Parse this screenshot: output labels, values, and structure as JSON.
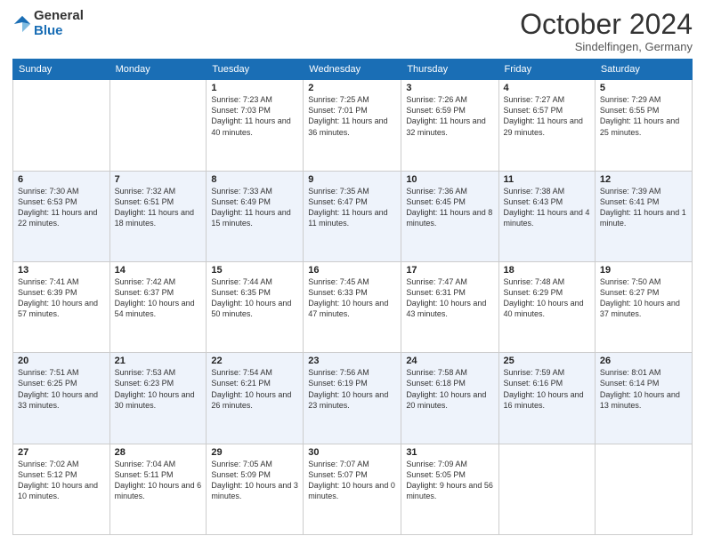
{
  "logo": {
    "line1": "General",
    "line2": "Blue"
  },
  "header": {
    "month": "October 2024",
    "location": "Sindelfingen, Germany"
  },
  "weekdays": [
    "Sunday",
    "Monday",
    "Tuesday",
    "Wednesday",
    "Thursday",
    "Friday",
    "Saturday"
  ],
  "weeks": [
    [
      {
        "day": "",
        "info": ""
      },
      {
        "day": "",
        "info": ""
      },
      {
        "day": "1",
        "info": "Sunrise: 7:23 AM\nSunset: 7:03 PM\nDaylight: 11 hours and 40 minutes."
      },
      {
        "day": "2",
        "info": "Sunrise: 7:25 AM\nSunset: 7:01 PM\nDaylight: 11 hours and 36 minutes."
      },
      {
        "day": "3",
        "info": "Sunrise: 7:26 AM\nSunset: 6:59 PM\nDaylight: 11 hours and 32 minutes."
      },
      {
        "day": "4",
        "info": "Sunrise: 7:27 AM\nSunset: 6:57 PM\nDaylight: 11 hours and 29 minutes."
      },
      {
        "day": "5",
        "info": "Sunrise: 7:29 AM\nSunset: 6:55 PM\nDaylight: 11 hours and 25 minutes."
      }
    ],
    [
      {
        "day": "6",
        "info": "Sunrise: 7:30 AM\nSunset: 6:53 PM\nDaylight: 11 hours and 22 minutes."
      },
      {
        "day": "7",
        "info": "Sunrise: 7:32 AM\nSunset: 6:51 PM\nDaylight: 11 hours and 18 minutes."
      },
      {
        "day": "8",
        "info": "Sunrise: 7:33 AM\nSunset: 6:49 PM\nDaylight: 11 hours and 15 minutes."
      },
      {
        "day": "9",
        "info": "Sunrise: 7:35 AM\nSunset: 6:47 PM\nDaylight: 11 hours and 11 minutes."
      },
      {
        "day": "10",
        "info": "Sunrise: 7:36 AM\nSunset: 6:45 PM\nDaylight: 11 hours and 8 minutes."
      },
      {
        "day": "11",
        "info": "Sunrise: 7:38 AM\nSunset: 6:43 PM\nDaylight: 11 hours and 4 minutes."
      },
      {
        "day": "12",
        "info": "Sunrise: 7:39 AM\nSunset: 6:41 PM\nDaylight: 11 hours and 1 minute."
      }
    ],
    [
      {
        "day": "13",
        "info": "Sunrise: 7:41 AM\nSunset: 6:39 PM\nDaylight: 10 hours and 57 minutes."
      },
      {
        "day": "14",
        "info": "Sunrise: 7:42 AM\nSunset: 6:37 PM\nDaylight: 10 hours and 54 minutes."
      },
      {
        "day": "15",
        "info": "Sunrise: 7:44 AM\nSunset: 6:35 PM\nDaylight: 10 hours and 50 minutes."
      },
      {
        "day": "16",
        "info": "Sunrise: 7:45 AM\nSunset: 6:33 PM\nDaylight: 10 hours and 47 minutes."
      },
      {
        "day": "17",
        "info": "Sunrise: 7:47 AM\nSunset: 6:31 PM\nDaylight: 10 hours and 43 minutes."
      },
      {
        "day": "18",
        "info": "Sunrise: 7:48 AM\nSunset: 6:29 PM\nDaylight: 10 hours and 40 minutes."
      },
      {
        "day": "19",
        "info": "Sunrise: 7:50 AM\nSunset: 6:27 PM\nDaylight: 10 hours and 37 minutes."
      }
    ],
    [
      {
        "day": "20",
        "info": "Sunrise: 7:51 AM\nSunset: 6:25 PM\nDaylight: 10 hours and 33 minutes."
      },
      {
        "day": "21",
        "info": "Sunrise: 7:53 AM\nSunset: 6:23 PM\nDaylight: 10 hours and 30 minutes."
      },
      {
        "day": "22",
        "info": "Sunrise: 7:54 AM\nSunset: 6:21 PM\nDaylight: 10 hours and 26 minutes."
      },
      {
        "day": "23",
        "info": "Sunrise: 7:56 AM\nSunset: 6:19 PM\nDaylight: 10 hours and 23 minutes."
      },
      {
        "day": "24",
        "info": "Sunrise: 7:58 AM\nSunset: 6:18 PM\nDaylight: 10 hours and 20 minutes."
      },
      {
        "day": "25",
        "info": "Sunrise: 7:59 AM\nSunset: 6:16 PM\nDaylight: 10 hours and 16 minutes."
      },
      {
        "day": "26",
        "info": "Sunrise: 8:01 AM\nSunset: 6:14 PM\nDaylight: 10 hours and 13 minutes."
      }
    ],
    [
      {
        "day": "27",
        "info": "Sunrise: 7:02 AM\nSunset: 5:12 PM\nDaylight: 10 hours and 10 minutes."
      },
      {
        "day": "28",
        "info": "Sunrise: 7:04 AM\nSunset: 5:11 PM\nDaylight: 10 hours and 6 minutes."
      },
      {
        "day": "29",
        "info": "Sunrise: 7:05 AM\nSunset: 5:09 PM\nDaylight: 10 hours and 3 minutes."
      },
      {
        "day": "30",
        "info": "Sunrise: 7:07 AM\nSunset: 5:07 PM\nDaylight: 10 hours and 0 minutes."
      },
      {
        "day": "31",
        "info": "Sunrise: 7:09 AM\nSunset: 5:05 PM\nDaylight: 9 hours and 56 minutes."
      },
      {
        "day": "",
        "info": ""
      },
      {
        "day": "",
        "info": ""
      }
    ]
  ]
}
